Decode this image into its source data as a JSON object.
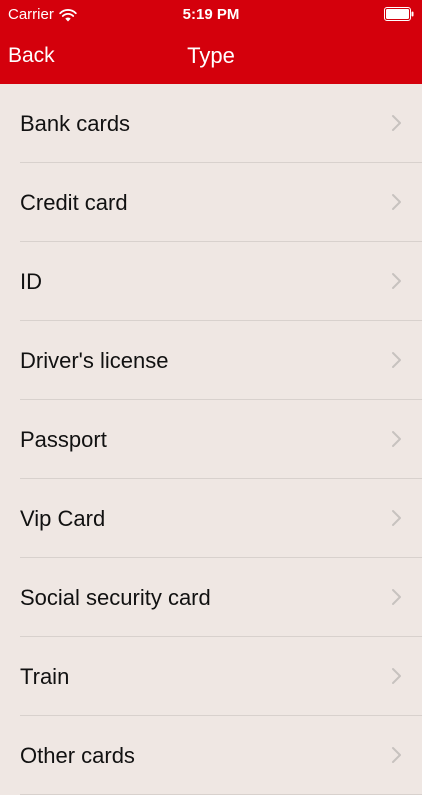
{
  "status_bar": {
    "carrier": "Carrier",
    "time": "5:19 PM",
    "wifi_icon": "wifi-icon",
    "battery_icon": "battery-icon"
  },
  "nav": {
    "back_label": "Back",
    "title": "Type"
  },
  "colors": {
    "header_red": "#d4000c",
    "background": "#efe7e3",
    "separator": "#d8d1cd",
    "chevron": "#c7c2bf"
  },
  "list": {
    "items": [
      {
        "label": "Bank cards"
      },
      {
        "label": "Credit card"
      },
      {
        "label": "ID"
      },
      {
        "label": "Driver's license"
      },
      {
        "label": "Passport"
      },
      {
        "label": "Vip Card"
      },
      {
        "label": "Social security card"
      },
      {
        "label": "Train"
      },
      {
        "label": "Other cards"
      }
    ]
  }
}
